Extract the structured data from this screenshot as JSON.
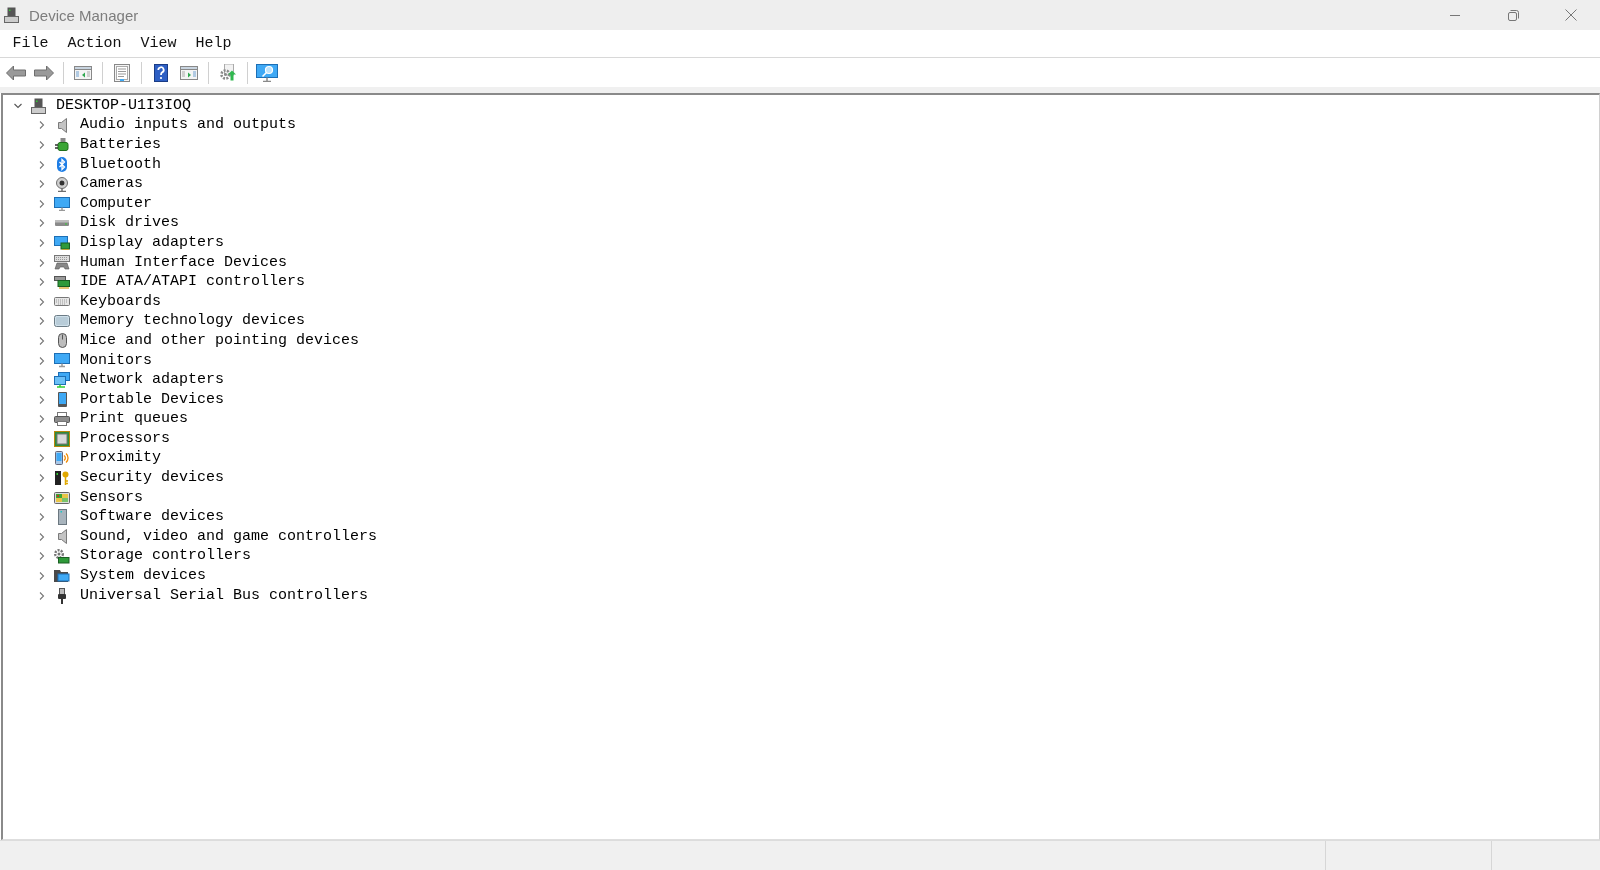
{
  "window": {
    "title": "Device Manager"
  },
  "menu_bar": [
    "File",
    "Action",
    "View",
    "Help"
  ],
  "tree": {
    "label": "DESKTOP-U1I3IOQ",
    "expanded": true,
    "children": [
      {
        "label": "Audio inputs and outputs",
        "expanded": false
      },
      {
        "label": "Batteries",
        "expanded": false
      },
      {
        "label": "Bluetooth",
        "expanded": false
      },
      {
        "label": "Cameras",
        "expanded": false
      },
      {
        "label": "Computer",
        "expanded": false
      },
      {
        "label": "Disk drives",
        "expanded": false
      },
      {
        "label": "Display adapters",
        "expanded": false
      },
      {
        "label": "Human Interface Devices",
        "expanded": false
      },
      {
        "label": "IDE ATA/ATAPI controllers",
        "expanded": false
      },
      {
        "label": "Keyboards",
        "expanded": false
      },
      {
        "label": "Memory technology devices",
        "expanded": false
      },
      {
        "label": "Mice and other pointing devices",
        "expanded": false
      },
      {
        "label": "Monitors",
        "expanded": false
      },
      {
        "label": "Network adapters",
        "expanded": false
      },
      {
        "label": "Portable Devices",
        "expanded": false
      },
      {
        "label": "Print queues",
        "expanded": false
      },
      {
        "label": "Processors",
        "expanded": false
      },
      {
        "label": "Proximity",
        "expanded": false
      },
      {
        "label": "Security devices",
        "expanded": false
      },
      {
        "label": "Sensors",
        "expanded": false
      },
      {
        "label": "Software devices",
        "expanded": false
      },
      {
        "label": "Sound, video and game controllers",
        "expanded": false
      },
      {
        "label": "Storage controllers",
        "expanded": false
      },
      {
        "label": "System devices",
        "expanded": false
      },
      {
        "label": "Universal Serial Bus controllers",
        "expanded": false
      }
    ]
  }
}
